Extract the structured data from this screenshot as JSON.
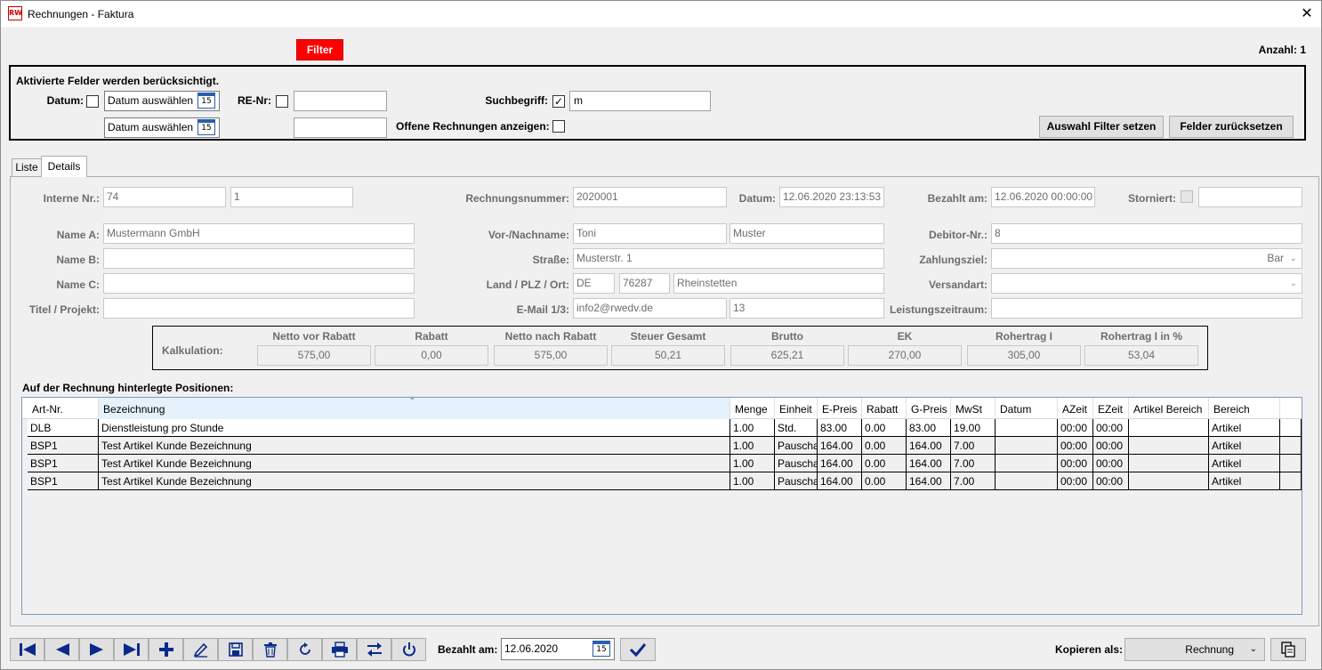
{
  "window": {
    "title": "Rechnungen - Faktura",
    "icon": "RW",
    "close": "✕"
  },
  "filter_button": "Filter",
  "anzahl": "Anzahl: 1",
  "filter": {
    "heading": "Aktivierte Felder werden berücksichtigt.",
    "datum_label": "Datum:",
    "date_placeholder_1": "Datum auswählen",
    "date_placeholder_2": "Datum auswählen",
    "cal_day": "15",
    "renr_label": "RE-Nr:",
    "renr_from": "",
    "renr_to": "",
    "suchbegriff_label": "Suchbegriff:",
    "suchbegriff_value": "m",
    "offene_label": "Offene Rechnungen anzeigen:",
    "apply_button": "Auswahl Filter setzen",
    "reset_button": "Felder zurücksetzen"
  },
  "tabs": {
    "liste": "Liste",
    "details": "Details"
  },
  "details": {
    "interne_nr_label": "Interne Nr.:",
    "interne_nr_1": "74",
    "interne_nr_2": "1",
    "rechnungsnummer_label": "Rechnungsnummer:",
    "rechnungsnummer": "2020001",
    "datum_label": "Datum:",
    "datum": "12.06.2020 23:13:53",
    "bezahlt_am_label": "Bezahlt am:",
    "bezahlt_am": "12.06.2020 00:00:00",
    "storniert_label": "Storniert:",
    "storniert_value": "",
    "name_a_label": "Name A:",
    "name_a": "Mustermann GmbH",
    "name_b_label": "Name B:",
    "name_b": "",
    "name_c_label": "Name C:",
    "name_c": "",
    "titel_label": "Titel / Projekt:",
    "titel": "",
    "vornachname_label": "Vor-/Nachname:",
    "vorname": "Toni",
    "nachname": "Muster",
    "strasse_label": "Straße:",
    "strasse": "Musterstr. 1",
    "landplzort_label": "Land / PLZ / Ort:",
    "land": "DE",
    "plz": "76287",
    "ort": "Rheinstetten",
    "email_label": "E-Mail 1/3:",
    "email": "info2@rwedv.de",
    "email_3": "13",
    "debitor_label": "Debitor-Nr.:",
    "debitor": "8",
    "zahlungsziel_label": "Zahlungsziel:",
    "zahlungsziel": "Bar",
    "versandart_label": "Versandart:",
    "versandart": "",
    "leistungszeitraum_label": "Leistungszeitraum:",
    "leistungszeitraum": ""
  },
  "kalkulation": {
    "label": "Kalkulation:",
    "columns": [
      {
        "head": "Netto vor Rabatt",
        "value": "575,00"
      },
      {
        "head": "Rabatt",
        "value": "0,00"
      },
      {
        "head": "Netto nach Rabatt",
        "value": "575,00"
      },
      {
        "head": "Steuer Gesamt",
        "value": "50,21"
      },
      {
        "head": "Brutto",
        "value": "625,21"
      },
      {
        "head": "EK",
        "value": "270,00"
      },
      {
        "head": "Rohertrag I",
        "value": "305,00"
      },
      {
        "head": "Rohertrag I in %",
        "value": "53,04"
      }
    ]
  },
  "positions": {
    "label": "Auf der Rechnung hinterlegte Positionen:",
    "headers": [
      "Art-Nr.",
      "Bezeichnung",
      "Menge",
      "Einheit",
      "E-Preis",
      "Rabatt",
      "G-Preis",
      "MwSt",
      "Datum",
      "AZeit",
      "EZeit",
      "Artikel Bereich",
      "Bereich"
    ],
    "sort_glyph": "▲",
    "rows": [
      [
        "DLB",
        "Dienstleistung pro Stunde",
        "1.00",
        "Std.",
        "83.00",
        "0.00",
        "83.00",
        "19.00",
        "",
        "00:00",
        "00:00",
        "",
        "Artikel"
      ],
      [
        "BSP1",
        "Test Artikel Kunde Bezeichnung",
        "1.00",
        "Pauscha",
        "164.00",
        "0.00",
        "164.00",
        "7.00",
        "",
        "00:00",
        "00:00",
        "",
        "Artikel"
      ],
      [
        "BSP1",
        "Test Artikel Kunde Bezeichnung",
        "1.00",
        "Pauscha",
        "164.00",
        "0.00",
        "164.00",
        "7.00",
        "",
        "00:00",
        "00:00",
        "",
        "Artikel"
      ],
      [
        "BSP1",
        "Test Artikel Kunde Bezeichnung",
        "1.00",
        "Pauscha",
        "164.00",
        "0.00",
        "164.00",
        "7.00",
        "",
        "00:00",
        "00:00",
        "",
        "Artikel"
      ]
    ]
  },
  "bottom": {
    "nav_icons": [
      "first-record-icon",
      "previous-record-icon",
      "next-record-icon",
      "last-record-icon",
      "add-icon",
      "edit-icon",
      "save-icon",
      "delete-icon",
      "refresh-icon",
      "print-icon",
      "swap-icon",
      "power-icon"
    ],
    "bezahlt_label": "Bezahlt am:",
    "bezahlt_value": "12.06.2020",
    "cal_day": "15",
    "kopieren_label": "Kopieren als:",
    "kopieren_value": "Rechnung"
  },
  "colors": {
    "filter_red": "#ff0000",
    "nav_blue": "#0a2a8a"
  }
}
